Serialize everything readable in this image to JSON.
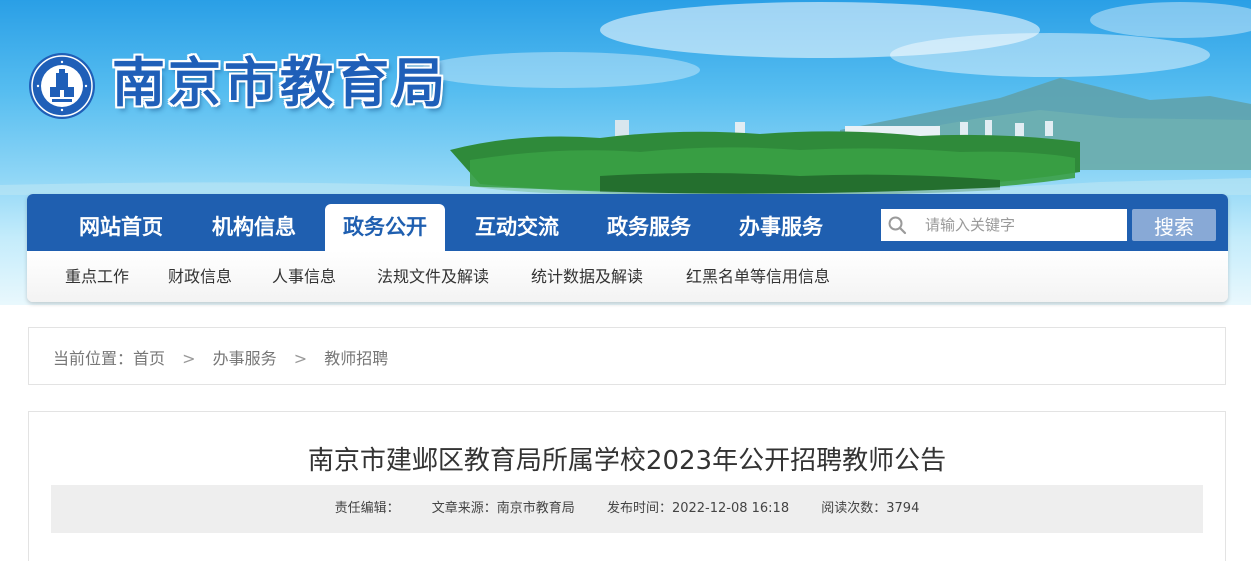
{
  "header": {
    "site_title": "南京市教育局",
    "emblem_text_outer": "南京市教育局 CHINA NANJING EDUCATION",
    "emblem_text_inner": "南京一教育"
  },
  "nav": {
    "items": [
      {
        "label": "网站首页",
        "active": false
      },
      {
        "label": "机构信息",
        "active": false
      },
      {
        "label": "政务公开",
        "active": true
      },
      {
        "label": "互动交流",
        "active": false
      },
      {
        "label": "政务服务",
        "active": false
      },
      {
        "label": "办事服务",
        "active": false
      }
    ],
    "search_placeholder": "请输入关键字",
    "search_button": "搜索"
  },
  "subnav": {
    "items": [
      "重点工作",
      "财政信息",
      "人事信息",
      "法规文件及解读",
      "统计数据及解读",
      "红黑名单等信用信息"
    ]
  },
  "breadcrumb": {
    "prefix": "当前位置：",
    "items": [
      "首页",
      "办事服务",
      "教师招聘"
    ],
    "separator": ">"
  },
  "article": {
    "title": "南京市建邺区教育局所属学校2023年公开招聘教师公告",
    "meta": {
      "editor": "责任编辑：",
      "source": "文章来源：南京市教育局",
      "published": "发布时间：2022-12-08 16:18",
      "views": "阅读次数：3794"
    }
  },
  "colors": {
    "nav_blue": "#1f5fb0",
    "title_blue": "#1f5fb8",
    "search_button": "#88a9d6"
  }
}
